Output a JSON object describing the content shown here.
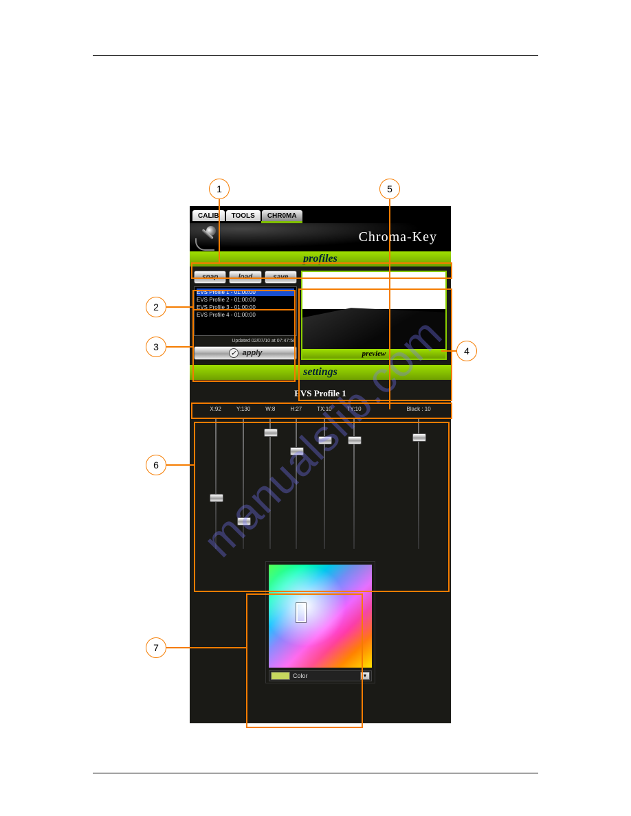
{
  "callouts": {
    "c1": "1",
    "c2": "2",
    "c3": "3",
    "c4": "4",
    "c5": "5",
    "c6": "6",
    "c7": "7"
  },
  "tabs": {
    "calib": "CALIB",
    "tools": "TOOLS",
    "chroma": "CHR0MA"
  },
  "title": "Chroma-Key",
  "sections": {
    "profiles": "profiles",
    "settings": "settings",
    "preview": "preview"
  },
  "buttons": {
    "snap": "snap",
    "load": "load",
    "save": "save",
    "apply": "apply"
  },
  "profiles": {
    "items": [
      {
        "label": "EVS Profile 1 - 01:00:00"
      },
      {
        "label": "EVS Profile 2 - 01:00:00"
      },
      {
        "label": "EVS Profile 3 - 01:00:00"
      },
      {
        "label": "EVS Profile 4 - 01:00:00"
      }
    ],
    "updated": "Updated 02/07/10 at 07:47:58"
  },
  "settings": {
    "title": "EVS Profile 1",
    "sliders": [
      {
        "label": "X:92",
        "pos": 58
      },
      {
        "label": "Y:130",
        "pos": 76
      },
      {
        "label": "W:8",
        "pos": 8
      },
      {
        "label": "H:27",
        "pos": 22
      },
      {
        "label": "TX:10",
        "pos": 14
      },
      {
        "label": "TY:10",
        "pos": 14
      },
      {
        "label": "Black : 10",
        "pos": 12
      }
    ]
  },
  "picker": {
    "label": "Color",
    "swatch": "#c7d85e"
  },
  "watermark": "manualslib.com"
}
